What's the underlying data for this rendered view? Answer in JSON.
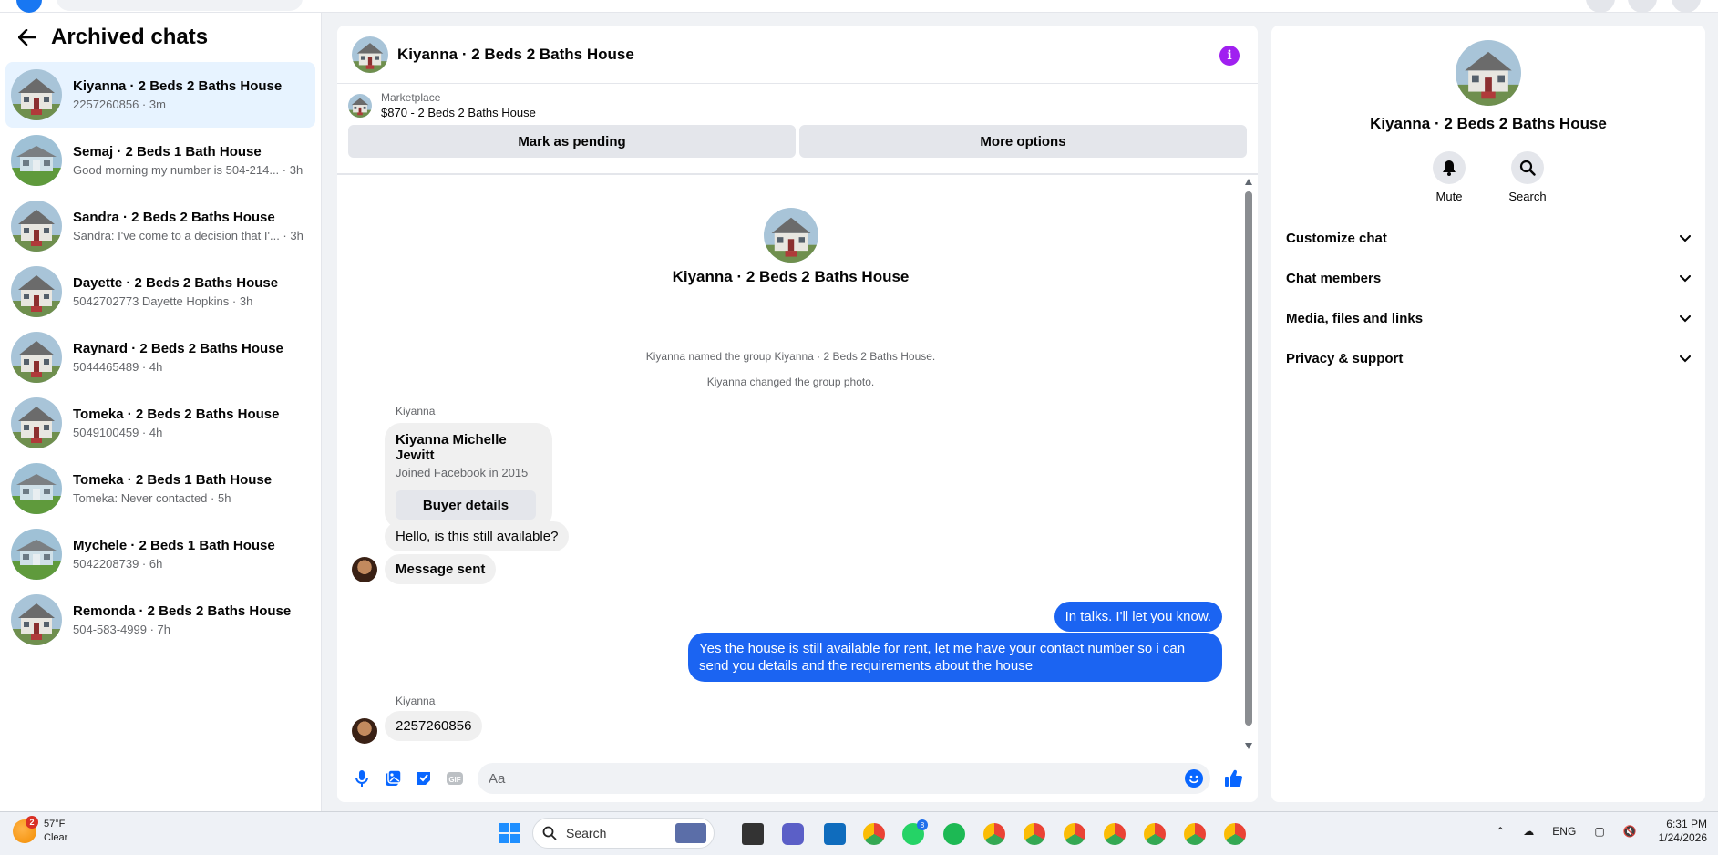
{
  "sidebar": {
    "title": "Archived chats",
    "chats": [
      {
        "name": "Kiyanna · 2 Beds 2 Baths House",
        "sub": "2257260856 · 3m",
        "active": true
      },
      {
        "name": "Semaj · 2 Beds 1 Bath House",
        "sub": "Good morning my number is 504-214... · 3h",
        "active": false
      },
      {
        "name": "Sandra · 2 Beds 2 Baths House",
        "sub": "Sandra: I've come to a decision that I'... · 3h",
        "active": false
      },
      {
        "name": "Dayette · 2 Beds 2 Baths House",
        "sub": "5042702773 Dayette Hopkins · 3h",
        "active": false
      },
      {
        "name": "Raynard · 2 Beds 2 Baths House",
        "sub": "5044465489 · 4h",
        "active": false
      },
      {
        "name": "Tomeka · 2 Beds 2 Baths House",
        "sub": "5049100459 · 4h",
        "active": false
      },
      {
        "name": "Tomeka · 2 Beds 1 Bath House",
        "sub": "Tomeka: Never contacted · 5h",
        "active": false
      },
      {
        "name": "Mychele · 2 Beds 1 Bath House",
        "sub": "5042208739 · 6h",
        "active": false
      },
      {
        "name": "Remonda · 2 Beds 2 Baths House",
        "sub": "504-583-4999 · 7h",
        "active": false
      }
    ]
  },
  "conversation": {
    "title": "Kiyanna · 2 Beds 2 Baths House",
    "marketplace_label": "Marketplace",
    "listing": "$870 - 2 Beds 2 Baths House",
    "mark_pending": "Mark as pending",
    "more_options": "More options",
    "intro_name": "Kiyanna · 2 Beds 2 Baths House",
    "system_1": "Kiyanna named the group Kiyanna · 2 Beds 2 Baths House.",
    "system_2": "Kiyanna changed the group photo.",
    "sender_1": "Kiyanna",
    "card_name": "Kiyanna Michelle Jewitt",
    "card_sub": "Joined Facebook in 2015",
    "card_button": "Buyer details",
    "msg_available": "Hello, is this still available?",
    "msg_sent": "Message sent",
    "msg_talks": "In talks. I'll let you know.",
    "msg_long": "Yes the house is still available for rent, let me have your contact number so i can send you details and the requirements about the house",
    "sender_2": "Kiyanna",
    "msg_number": "2257260856",
    "composer_placeholder": "Aa"
  },
  "right_panel": {
    "name": "Kiyanna · 2 Beds 2 Baths House",
    "mute": "Mute",
    "search": "Search",
    "sections": [
      "Customize chat",
      "Chat members",
      "Media, files and links",
      "Privacy & support"
    ]
  },
  "taskbar": {
    "temp": "57°F",
    "condition": "Clear",
    "weather_badge": "2",
    "search": "Search",
    "whatsapp_badge": "8",
    "lang": "ENG",
    "time": "6:31 PM",
    "date": "1/24/2026"
  },
  "colors": {
    "accent_blue": "#1b64f2",
    "active_chat_bg": "#e7f3ff",
    "info_purple": "#a020f0"
  }
}
